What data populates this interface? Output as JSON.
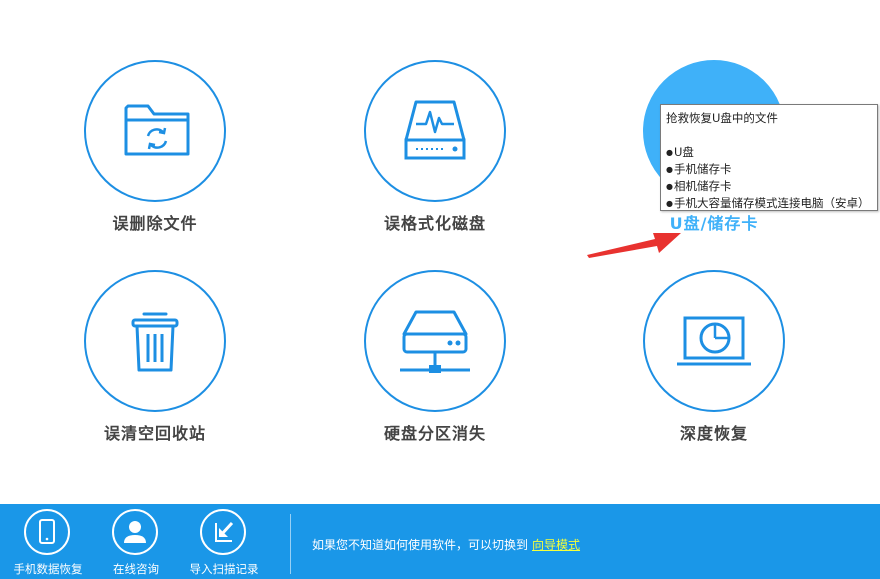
{
  "tiles": [
    {
      "label": "误删除文件",
      "icon": "folder-recycle-icon"
    },
    {
      "label": "误格式化磁盘",
      "icon": "disk-pulse-icon"
    },
    {
      "label": "U盘/储存卡",
      "icon": "usb-card-icon"
    },
    {
      "label": "误清空回收站",
      "icon": "trash-bin-icon"
    },
    {
      "label": "硬盘分区消失",
      "icon": "network-drive-icon"
    },
    {
      "label": "深度恢复",
      "icon": "laptop-scan-icon"
    }
  ],
  "tooltip": {
    "title": "抢救恢复U盘中的文件",
    "items": [
      "U盘",
      "手机储存卡",
      "相机储存卡",
      "手机大容量储存模式连接电脑（安卓）"
    ]
  },
  "footer": {
    "buttons": [
      {
        "label": "手机数据恢复",
        "icon": "phone-icon"
      },
      {
        "label": "在线咨询",
        "icon": "user-support-icon"
      },
      {
        "label": "导入扫描记录",
        "icon": "import-arrow-icon"
      }
    ],
    "hint_text": "如果您不知道如何使用软件，可以切换到",
    "hint_link": "向导模式"
  },
  "colors": {
    "accent": "#1d8fe3",
    "active": "#3fb1f9",
    "footer_bg": "#1a97e8",
    "link": "#f5ff3a",
    "arrow": "#e8322f"
  }
}
